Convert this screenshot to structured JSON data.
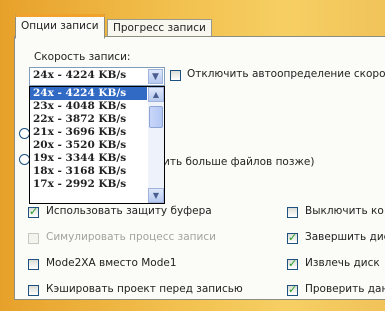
{
  "tabs": [
    {
      "label": "Опции записи",
      "active": true
    },
    {
      "label": "Прогресс записи",
      "active": false
    }
  ],
  "speed": {
    "label": "Скорость записи:",
    "selected": "24x - 4224 KB/s",
    "options": [
      "24x - 4224 KB/s",
      "23x - 4048 KB/s",
      "22x - 3872 KB/s",
      "21x - 3696 KB/s",
      "20x - 3520 KB/s",
      "19x - 3344 KB/s",
      "18x - 3168 KB/s",
      "17x - 2992 KB/s"
    ]
  },
  "autodetect": {
    "label": "Отключить автоопределение скорос",
    "checked": false
  },
  "partial_text": "ить больше файлов позже)",
  "left_options": [
    {
      "label": "Использовать защиту буфера",
      "checked": true,
      "disabled": false
    },
    {
      "label": "Симулировать процесс записи",
      "checked": false,
      "disabled": true
    },
    {
      "label": "Mode2XA вместо Mode1",
      "checked": false,
      "disabled": false
    },
    {
      "label": "Кэшировать проект перед записью",
      "checked": false,
      "disabled": false
    }
  ],
  "right_options": [
    {
      "label": "Выключить ко",
      "checked": false
    },
    {
      "label": "Завершить дис",
      "checked": true
    },
    {
      "label": "Извлечь диск",
      "checked": true
    },
    {
      "label": "Проверить дан",
      "checked": true
    }
  ],
  "colors": {
    "accent": "#f0a22d",
    "selection": "#316ac5",
    "check_mark": "#21a121"
  }
}
